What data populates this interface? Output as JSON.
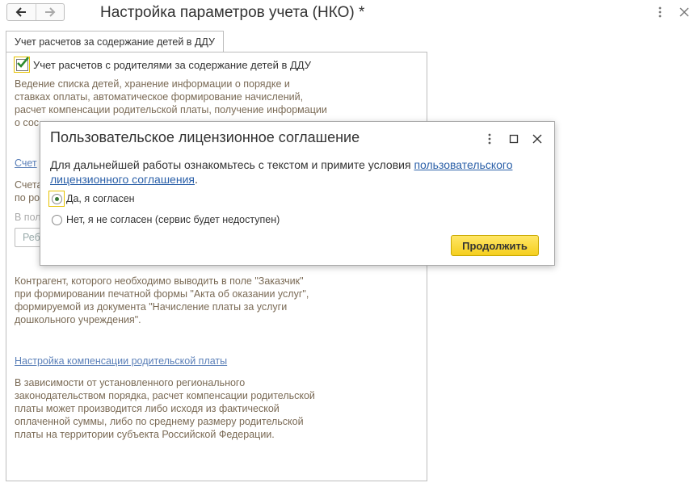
{
  "window": {
    "title": "Настройка параметров учета (НКО) *"
  },
  "tabs": [
    {
      "label": "Учет расчетов за содержание детей в ДДУ"
    }
  ],
  "form": {
    "checkbox_label": "Учет расчетов с родителями за содержание детей в ДДУ",
    "checkbox_checked": true,
    "desc_lines": [
      "Ведение списка детей, хранение информации о порядке и",
      "ставках оплаты, автоматическое формирование начислений,",
      "расчет компенсации родительской платы, получение информации",
      "о сос"
    ],
    "link_fragment": "Счет",
    "text_fragment_lines": [
      "Счета",
      "по ро"
    ],
    "gray_fragment": "В пол",
    "input_fragment": "Реб",
    "contractor_lines": [
      "Контрагент, которого необходимо выводить в поле \"Заказчик\"",
      "при формировании печатной формы \"Акта об оказании услуг\",",
      "формируемой из документа \"Начисление платы за услуги",
      "дошкольного учреждения\"."
    ],
    "compensation_link": "Настройка компенсации родительской платы",
    "compensation_lines": [
      "В зависимости от установленного регионального",
      "законодательством порядка, расчет компенсации родительской",
      "платы может производится либо исходя из фактической",
      "оплаченной суммы, либо по среднему размеру родительской",
      "платы на территории субъекта Российской Федерации."
    ]
  },
  "dialog": {
    "title": "Пользовательское лицензионное соглашение",
    "text_before": "Для дальнейшей работы ознакомьтесь с текстом и примите условия ",
    "link_text_line1": "пользовательского",
    "link_text_line2": "лицензионного соглашения",
    "text_after": ".",
    "options": [
      {
        "label": "Да, я согласен",
        "selected": true
      },
      {
        "label": "Нет, я не согласен (сервис будет недоступен)",
        "selected": false
      }
    ],
    "continue_label": "Продолжить"
  }
}
